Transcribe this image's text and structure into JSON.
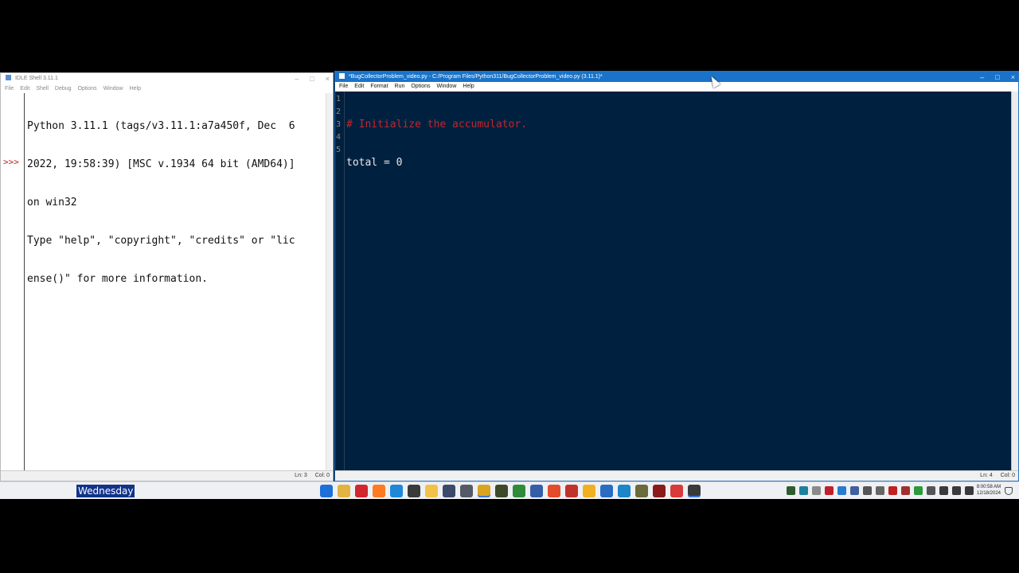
{
  "shell": {
    "title": "IDLE Shell 3.11.1",
    "menu": [
      "File",
      "Edit",
      "Shell",
      "Debug",
      "Options",
      "Window",
      "Help"
    ],
    "output_lines": [
      "Python 3.11.1 (tags/v3.11.1:a7a450f, Dec  6",
      "2022, 19:58:39) [MSC v.1934 64 bit (AMD64)]",
      "on win32",
      "Type \"help\", \"copyright\", \"credits\" or \"lic",
      "ense()\" for more information."
    ],
    "prompt": ">>>",
    "status": {
      "ln": "Ln: 3",
      "col": "Col: 0"
    }
  },
  "editor": {
    "title": "*BugCollectorProblem_video.py - C:/Program Files/Python311/BugCollectorProblem_video.py (3.11.1)*",
    "menu": [
      "File",
      "Edit",
      "Format",
      "Run",
      "Options",
      "Window",
      "Help"
    ],
    "line_numbers": [
      "1",
      "2",
      "3",
      "4",
      "5"
    ],
    "code_lines": [
      {
        "text": "# Initialize the accumulator.",
        "kind": "comment"
      },
      {
        "text": "total = 0",
        "kind": "code"
      },
      {
        "text": "",
        "kind": "code"
      },
      {
        "text": "",
        "kind": "code"
      },
      {
        "text": "",
        "kind": "code"
      }
    ],
    "status": {
      "ln": "Ln: 4",
      "col": "Col: 0"
    }
  },
  "window_controls": {
    "minimize": "–",
    "maximize": "□",
    "close": "×"
  },
  "taskbar": {
    "weekday_label": "Wednesday",
    "apps": [
      {
        "name": "start-icon",
        "color": "#1e6fd9"
      },
      {
        "name": "chrome-icon",
        "color": "#e2b340"
      },
      {
        "name": "opera-icon",
        "color": "#d2262e"
      },
      {
        "name": "firefox-icon",
        "color": "#ff7a20"
      },
      {
        "name": "edge-icon",
        "color": "#1e88d8"
      },
      {
        "name": "pen-icon",
        "color": "#3a3a3a"
      },
      {
        "name": "folder-icon",
        "color": "#f2c14a"
      },
      {
        "name": "store-icon",
        "color": "#3b4a6a"
      },
      {
        "name": "terminal-icon",
        "color": "#555b66"
      },
      {
        "name": "python-idle-icon",
        "color": "#d9a520",
        "active": true
      },
      {
        "name": "tool-icon",
        "color": "#3c4a2a"
      },
      {
        "name": "sheet-icon",
        "color": "#2e8b3a"
      },
      {
        "name": "monitor-icon",
        "color": "#345fa8"
      },
      {
        "name": "record-icon",
        "color": "#e34b2a"
      },
      {
        "name": "x-tool-icon",
        "color": "#c0332b"
      },
      {
        "name": "paint-icon",
        "color": "#f0b020"
      },
      {
        "name": "doc-icon",
        "color": "#2a6cc4"
      },
      {
        "name": "calc-icon",
        "color": "#1b86c9"
      },
      {
        "name": "brush-icon",
        "color": "#6a6a3a"
      },
      {
        "name": "camera-icon",
        "color": "#8a1a1a"
      },
      {
        "name": "check-icon",
        "color": "#d93a3a"
      },
      {
        "name": "editor-icon",
        "color": "#3a3a3a",
        "active": true
      }
    ],
    "tray_icons": [
      {
        "name": "tray-app-icon",
        "color": "#2f5d2f"
      },
      {
        "name": "tray-net-icon",
        "color": "#1f7f9f"
      },
      {
        "name": "tray-box-icon",
        "color": "#8a8a8a"
      },
      {
        "name": "tray-pdf-icon",
        "color": "#c0202a"
      },
      {
        "name": "tray-cloud-icon",
        "color": "#2a7ad0"
      },
      {
        "name": "tray-shield-icon",
        "color": "#4060a0"
      },
      {
        "name": "tray-window-icon",
        "color": "#555555"
      },
      {
        "name": "tray-mini-icon",
        "color": "#666666"
      },
      {
        "name": "tray-x-icon",
        "color": "#c02020"
      },
      {
        "name": "tray-doc-icon",
        "color": "#a03030"
      },
      {
        "name": "tray-green-icon",
        "color": "#2a9a3a"
      },
      {
        "name": "tray-usb-icon",
        "color": "#555555"
      },
      {
        "name": "tray-wifi-icon",
        "color": "#3a3a3a"
      },
      {
        "name": "tray-sound-icon",
        "color": "#3a3a3a"
      },
      {
        "name": "tray-battery-icon",
        "color": "#3a3a3a"
      }
    ],
    "clock_time": "8:00:58 AM",
    "clock_date": "12/18/2024"
  }
}
